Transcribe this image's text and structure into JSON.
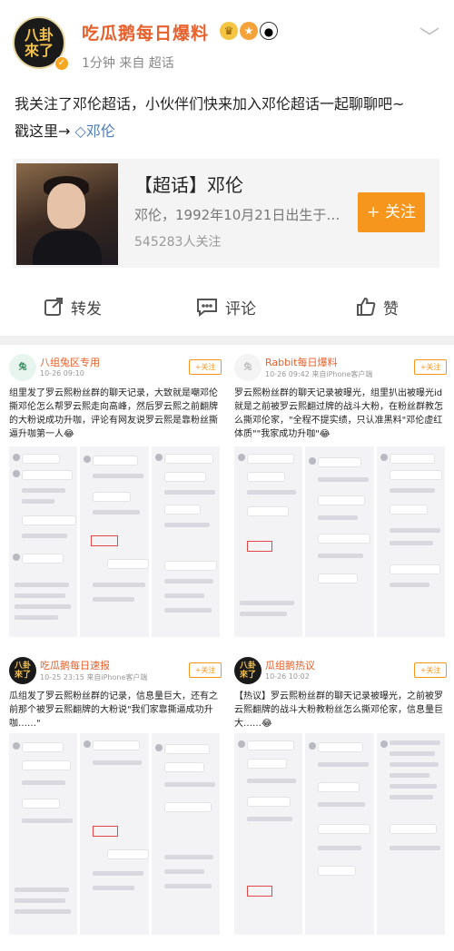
{
  "post": {
    "avatar_text": [
      "八卦",
      "來了"
    ],
    "author": "吃瓜鹅每日爆料",
    "meta": "1分钟  来自 超话",
    "content_line1": "我关注了邓伦超话，小伙伴们快来加入邓伦超话一起聊聊吧~",
    "content_line2_prefix": "戳这里→",
    "topic_link": "邓伦",
    "card": {
      "title": "【超话】邓伦",
      "desc": "邓伦，1992年10月21日出生于…",
      "count": "545283人关注",
      "follow_label": "+ 关注"
    },
    "actions": {
      "repost": "转发",
      "comment": "评论",
      "like": "赞"
    }
  },
  "tiles": [
    {
      "name": "八组兔区专用",
      "time": "10-26 09:10",
      "follow": "+关注",
      "text": "组里发了罗云熙粉丝群的聊天记录，大致就是嘲邓伦撕邓伦怎么帮罗云熙走向高峰，然后罗云熙之前翻牌的大粉说成功升咖，评论有网友说罗云熙是靠粉丝撕逼升咖第一人😂"
    },
    {
      "name": "Rabbit每日爆料",
      "time": "10-26 09:42 来自iPhone客户端",
      "follow": "+关注",
      "text": "罗云熙粉丝群的聊天记录被曝光，组里扒出被曝光id就是之前被罗云熙翻过牌的战斗大粉，在粉丝群教怎么撕邓伦家，\"全程不提实绩，只认准黑料\"邓伦虚红体质\"\"我家成功升咖\"😂"
    },
    {
      "name": "吃瓜鹅每日速报",
      "time": "10-25 23:15 来自iPhone客户端",
      "follow": "+关注",
      "text": "瓜组发了罗云熙粉丝群的记录，信息量巨大，还有之前那个被罗云熙翻牌的大粉说\"我们家靠撕逼成功升咖……\""
    },
    {
      "name": "瓜组鹅热议",
      "time": "10-26 10:02",
      "follow": "+关注",
      "text": "【热议】罗云熙粉丝群的聊天记录被曝光，之前被罗云熙翻牌的战斗大粉教粉丝怎么撕邓伦家，信息量巨大……😂"
    }
  ],
  "colors": {
    "author": "#e8602c",
    "link": "#4a7bbd",
    "follow": "#f7961d"
  }
}
